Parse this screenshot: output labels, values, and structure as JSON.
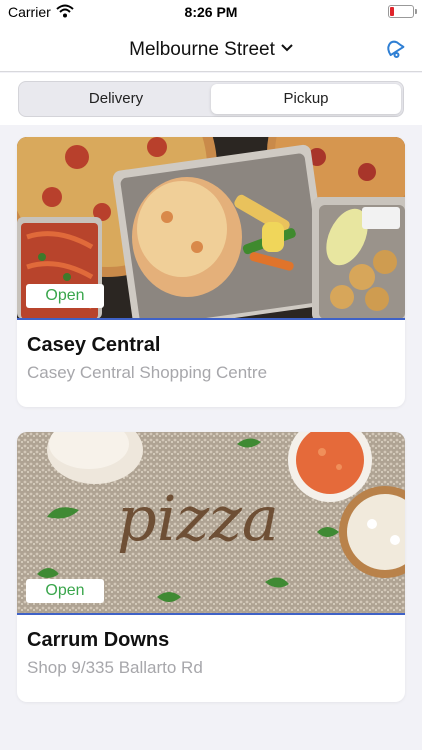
{
  "status_bar": {
    "carrier": "Carrier",
    "time": "8:26 PM"
  },
  "header": {
    "location": "Melbourne Street",
    "icons": [
      "chevron-down-icon",
      "notification-bell-icon"
    ]
  },
  "order_mode": {
    "tabs": [
      "Delivery",
      "Pickup"
    ],
    "selected": "Pickup"
  },
  "stores": [
    {
      "status": "Open",
      "name": "Casey Central",
      "address": "Casey Central Shopping Centre",
      "image": "pizza-and-parmigiana-photo"
    },
    {
      "status": "Open",
      "name": "Carrum Downs",
      "address": "Shop 9/335 Ballarto Rd",
      "image": "flour-pizza-lettering-photo",
      "image_text": "pizza"
    }
  ],
  "colors": {
    "open_green": "#3aa64c",
    "accent_blue": "#3f62c7",
    "background": "#f2f2f7"
  }
}
